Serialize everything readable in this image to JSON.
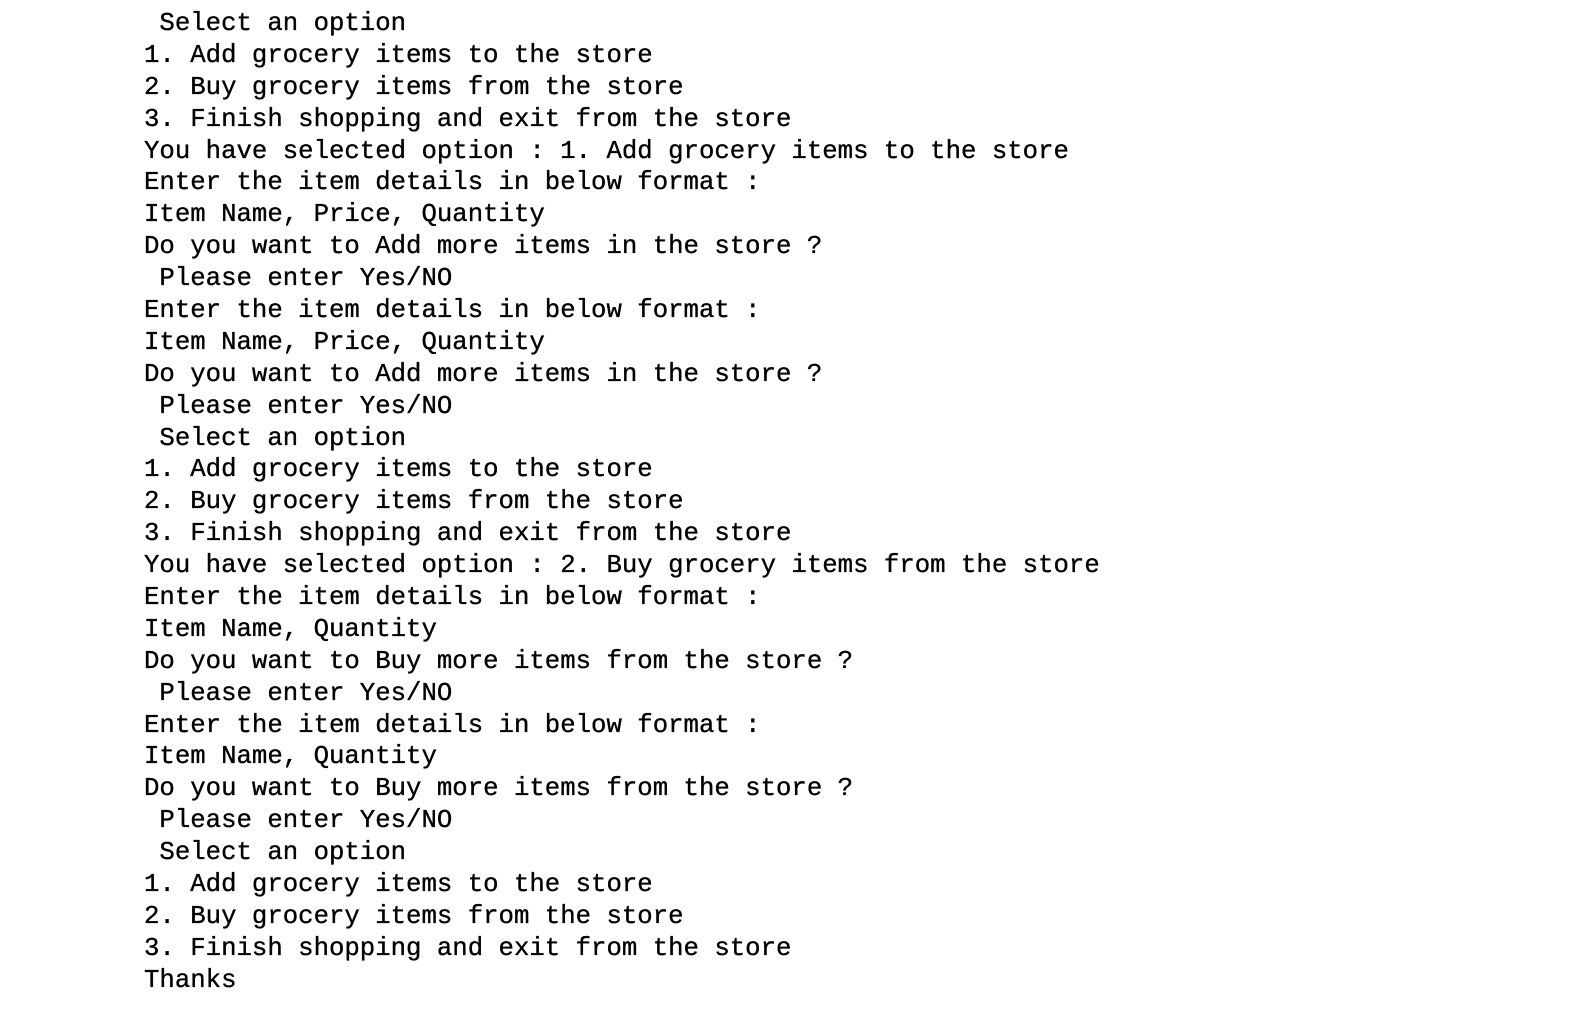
{
  "console": {
    "lines": [
      " Select an option",
      "1. Add grocery items to the store",
      "2. Buy grocery items from the store",
      "3. Finish shopping and exit from the store",
      "You have selected option : 1. Add grocery items to the store",
      "Enter the item details in below format :",
      "Item Name, Price, Quantity",
      "Do you want to Add more items in the store ?",
      " Please enter Yes/NO",
      "Enter the item details in below format :",
      "Item Name, Price, Quantity",
      "Do you want to Add more items in the store ?",
      " Please enter Yes/NO",
      " Select an option",
      "1. Add grocery items to the store",
      "2. Buy grocery items from the store",
      "3. Finish shopping and exit from the store",
      "You have selected option : 2. Buy grocery items from the store",
      "Enter the item details in below format :",
      "Item Name, Quantity",
      "Do you want to Buy more items from the store ?",
      " Please enter Yes/NO",
      "Enter the item details in below format :",
      "Item Name, Quantity",
      "Do you want to Buy more items from the store ?",
      " Please enter Yes/NO",
      " Select an option",
      "1. Add grocery items to the store",
      "2. Buy grocery items from the store",
      "3. Finish shopping and exit from the store",
      "Thanks"
    ]
  }
}
